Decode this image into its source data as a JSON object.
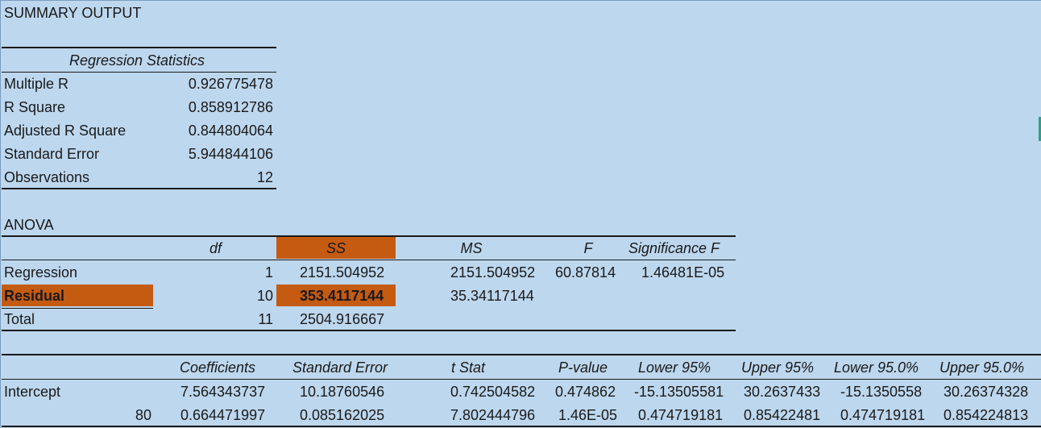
{
  "title": "SUMMARY OUTPUT",
  "regression_statistics": {
    "header": "Regression Statistics",
    "rows": [
      {
        "label": "Multiple R",
        "value": "0.926775478"
      },
      {
        "label": "R Square",
        "value": "0.858912786"
      },
      {
        "label": "Adjusted R Square",
        "value": "0.844804064"
      },
      {
        "label": "Standard Error",
        "value": "5.944844106"
      },
      {
        "label": "Observations",
        "value": "12"
      }
    ]
  },
  "anova": {
    "title": "ANOVA",
    "headers": [
      "df",
      "SS",
      "MS",
      "F",
      "Significance F"
    ],
    "rows": [
      {
        "label": "Regression",
        "df": "1",
        "ss": "2151.504952",
        "ms": "2151.504952",
        "f": "60.87814",
        "sig": "1.46481E-05"
      },
      {
        "label": "Residual",
        "df": "10",
        "ss": "353.4117144",
        "ms": "35.34117144",
        "f": "",
        "sig": ""
      },
      {
        "label": "Total",
        "df": "11",
        "ss": "2504.916667",
        "ms": "",
        "f": "",
        "sig": ""
      }
    ],
    "highlight_color": "#c55a11"
  },
  "coefficients": {
    "headers": [
      "Coefficients",
      "Standard Error",
      "t Stat",
      "P-value",
      "Lower 95%",
      "Upper 95%",
      "Lower 95.0%",
      "Upper 95.0%"
    ],
    "rows": [
      {
        "label": "Intercept",
        "values": [
          "7.564343737",
          "10.18760546",
          "0.742504582",
          "0.474862",
          "-15.13505581",
          "30.2637433",
          "-15.1350558",
          "30.26374328"
        ]
      },
      {
        "label": "80",
        "values": [
          "0.664471997",
          "0.085162025",
          "7.802444796",
          "1.46E-05",
          "0.474719181",
          "0.85422481",
          "0.474719181",
          "0.854224813"
        ]
      }
    ]
  }
}
